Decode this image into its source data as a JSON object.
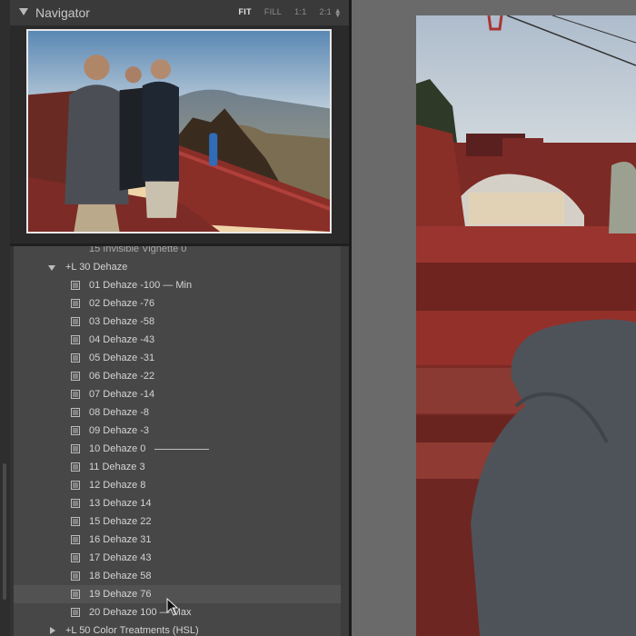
{
  "navigator": {
    "title": "Navigator",
    "zoom_options": [
      "FIT",
      "FILL",
      "1:1",
      "2:1"
    ],
    "active_zoom": "FIT"
  },
  "presets": {
    "partial_item": "15 Invisible Vignette 0",
    "folder_open": "+L 30 Dehaze",
    "items": [
      "01 Dehaze -100 — Min",
      "02 Dehaze -76",
      "03 Dehaze -58",
      "04 Dehaze -43",
      "05 Dehaze -31",
      "06 Dehaze -22",
      "07 Dehaze -14",
      "08 Dehaze -8",
      "09 Dehaze -3",
      "10 Dehaze 0",
      "11 Dehaze 3",
      "12 Dehaze 8",
      "13 Dehaze 14",
      "15 Dehaze 22",
      "16 Dehaze 31",
      "17 Dehaze 43",
      "18 Dehaze 58",
      "19 Dehaze 76",
      "20 Dehaze 100 — Max"
    ],
    "folder_closed": "+L 50 Color Treatments (HSL)",
    "highlighted_item": "19 Dehaze 76"
  },
  "colors": {
    "panel_bg": "#333333",
    "list_bg": "#474747",
    "highlight": "#525252",
    "text": "#d4d4d4",
    "workspace_gray": "#6a6a6a"
  }
}
